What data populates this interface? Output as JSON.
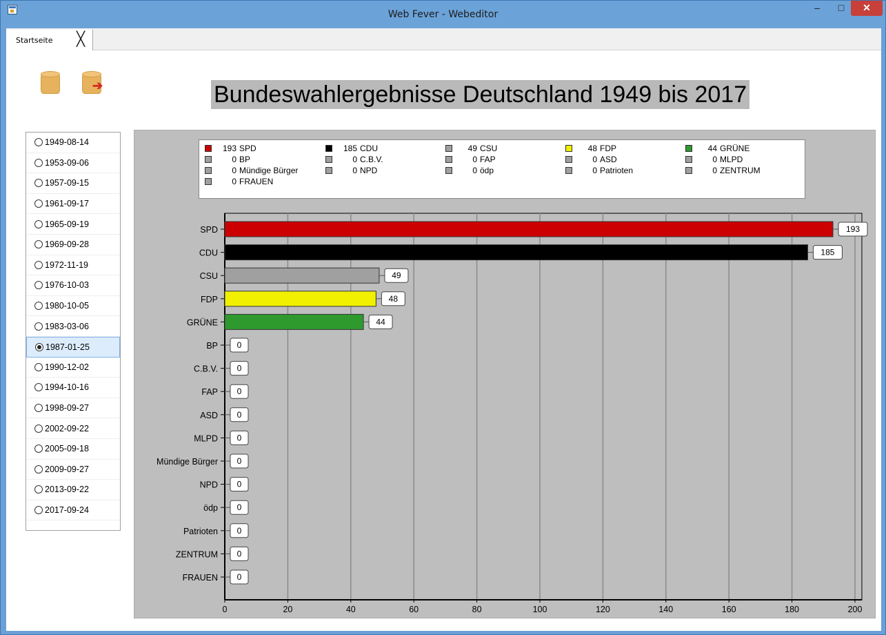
{
  "window": {
    "title": "Web Fever - Webeditor",
    "minimize_label": "–",
    "maximize_label": "□",
    "close_label": "✕"
  },
  "tabs": [
    {
      "label": "Startseite",
      "close_label": "╳"
    }
  ],
  "toolbar": {
    "open_icon": "database-icon",
    "export_icon": "database-export-icon"
  },
  "heading": "Bundeswahlergebnisse Deutschland 1949 bis 2017",
  "dates": [
    {
      "label": "1949-08-14",
      "selected": false
    },
    {
      "label": "1953-09-06",
      "selected": false
    },
    {
      "label": "1957-09-15",
      "selected": false
    },
    {
      "label": "1961-09-17",
      "selected": false
    },
    {
      "label": "1965-09-19",
      "selected": false
    },
    {
      "label": "1969-09-28",
      "selected": false
    },
    {
      "label": "1972-11-19",
      "selected": false
    },
    {
      "label": "1976-10-03",
      "selected": false
    },
    {
      "label": "1980-10-05",
      "selected": false
    },
    {
      "label": "1983-03-06",
      "selected": false
    },
    {
      "label": "1987-01-25",
      "selected": true
    },
    {
      "label": "1990-12-02",
      "selected": false
    },
    {
      "label": "1994-10-16",
      "selected": false
    },
    {
      "label": "1998-09-27",
      "selected": false
    },
    {
      "label": "2002-09-22",
      "selected": false
    },
    {
      "label": "2005-09-18",
      "selected": false
    },
    {
      "label": "2009-09-27",
      "selected": false
    },
    {
      "label": "2013-09-22",
      "selected": false
    },
    {
      "label": "2017-09-24",
      "selected": false
    }
  ],
  "chart_data": {
    "type": "bar",
    "orientation": "horizontal",
    "title": "",
    "xlabel": "",
    "ylabel": "",
    "xlim": [
      0,
      200
    ],
    "ticks": [
      0,
      20,
      40,
      60,
      80,
      100,
      120,
      140,
      160,
      180,
      200
    ],
    "grid": true,
    "legend_position": "top",
    "categories": [
      "SPD",
      "CDU",
      "CSU",
      "FDP",
      "GRÜNE",
      "BP",
      "C.B.V.",
      "FAP",
      "ASD",
      "MLPD",
      "Mündige Bürger",
      "NPD",
      "ödp",
      "Patrioten",
      "ZENTRUM",
      "FRAUEN"
    ],
    "values": [
      193,
      185,
      49,
      48,
      44,
      0,
      0,
      0,
      0,
      0,
      0,
      0,
      0,
      0,
      0,
      0
    ],
    "colors": [
      "#cc0000",
      "#000000",
      "#a0a0a0",
      "#f0f000",
      "#2e9a2e",
      "#a0a0a0",
      "#a0a0a0",
      "#a0a0a0",
      "#a0a0a0",
      "#a0a0a0",
      "#a0a0a0",
      "#a0a0a0",
      "#a0a0a0",
      "#a0a0a0",
      "#a0a0a0",
      "#a0a0a0"
    ],
    "legend": [
      {
        "value": "193",
        "name": "SPD",
        "color": "#cc0000"
      },
      {
        "value": "185",
        "name": "CDU",
        "color": "#000000"
      },
      {
        "value": "49",
        "name": "CSU",
        "color": "#a0a0a0"
      },
      {
        "value": "48",
        "name": "FDP",
        "color": "#f0f000"
      },
      {
        "value": "44",
        "name": "GRÜNE",
        "color": "#2e9a2e"
      },
      {
        "value": "0",
        "name": "BP",
        "color": "#a0a0a0"
      },
      {
        "value": "0",
        "name": "C.B.V.",
        "color": "#a0a0a0"
      },
      {
        "value": "0",
        "name": "FAP",
        "color": "#a0a0a0"
      },
      {
        "value": "0",
        "name": "ASD",
        "color": "#a0a0a0"
      },
      {
        "value": "0",
        "name": "MLPD",
        "color": "#a0a0a0"
      },
      {
        "value": "0",
        "name": "Mündige Bürger",
        "color": "#a0a0a0"
      },
      {
        "value": "0",
        "name": "NPD",
        "color": "#a0a0a0"
      },
      {
        "value": "0",
        "name": "ödp",
        "color": "#a0a0a0"
      },
      {
        "value": "0",
        "name": "Patrioten",
        "color": "#a0a0a0"
      },
      {
        "value": "0",
        "name": "ZENTRUM",
        "color": "#a0a0a0"
      },
      {
        "value": "0",
        "name": "FRAUEN",
        "color": "#a0a0a0"
      }
    ]
  }
}
